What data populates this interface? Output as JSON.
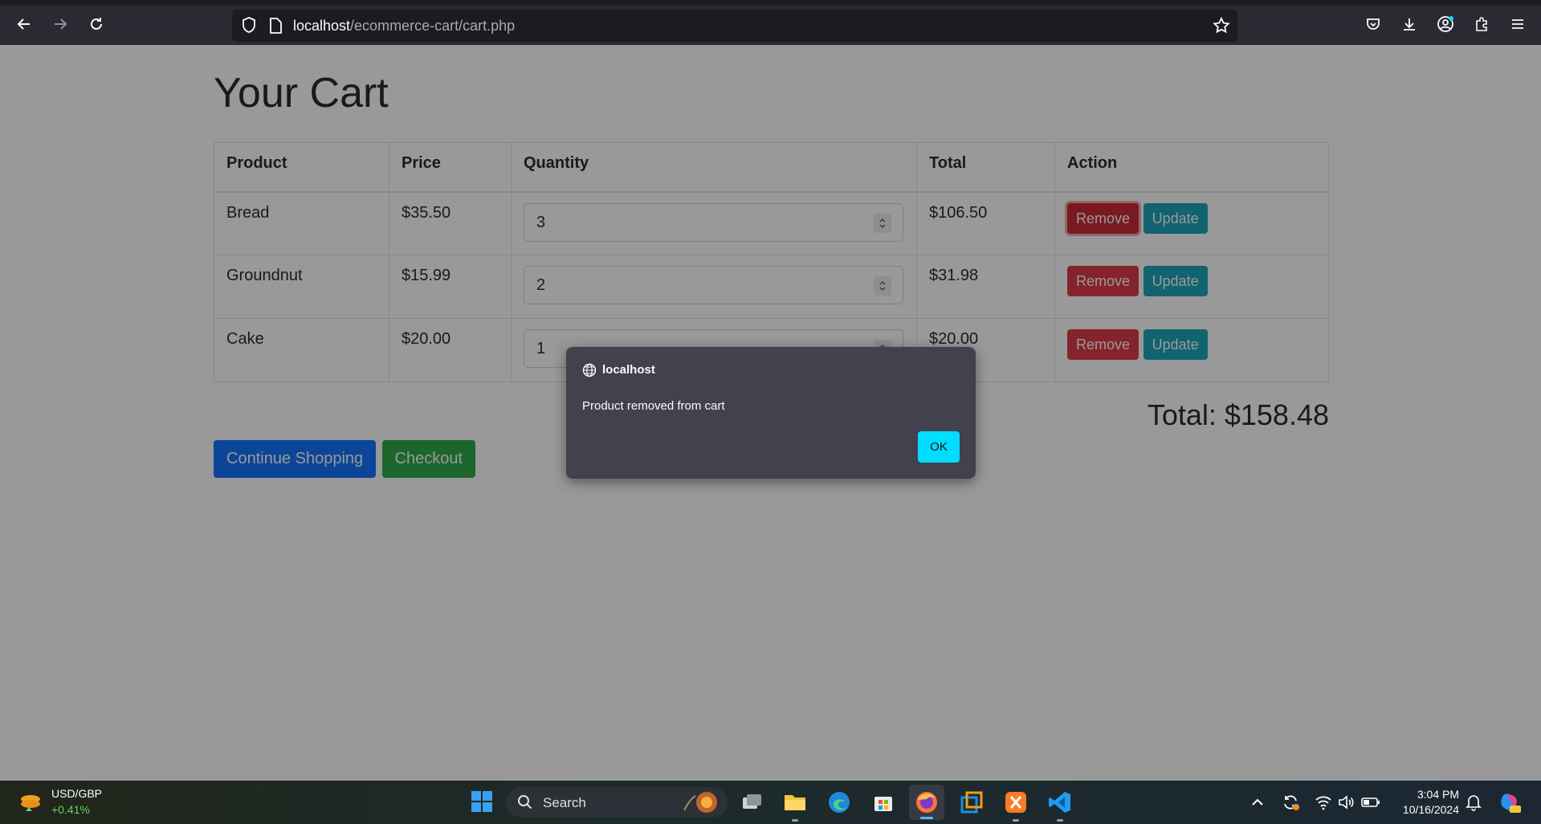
{
  "browser": {
    "url_host": "localhost",
    "url_path": "/ecommerce-cart/cart.php"
  },
  "page": {
    "title": "Your Cart",
    "table": {
      "headers": [
        "Product",
        "Price",
        "Quantity",
        "Total",
        "Action"
      ],
      "rows": [
        {
          "product": "Bread",
          "price": "$35.50",
          "quantity": "3",
          "total": "$106.50",
          "remove_label": "Remove",
          "update_label": "Update"
        },
        {
          "product": "Groundnut",
          "price": "$15.99",
          "quantity": "2",
          "total": "$31.98",
          "remove_label": "Remove",
          "update_label": "Update"
        },
        {
          "product": "Cake",
          "price": "$20.00",
          "quantity": "1",
          "total": "$20.00",
          "remove_label": "Remove",
          "update_label": "Update"
        }
      ]
    },
    "grand_total": "Total: $158.48",
    "continue_label": "Continue Shopping",
    "checkout_label": "Checkout"
  },
  "dialog": {
    "origin": "localhost",
    "message": "Product removed from cart",
    "ok_label": "OK"
  },
  "taskbar": {
    "widget_label": "USD/GBP",
    "widget_value": "+0.41%",
    "search_label": "Search",
    "time": "3:04 PM",
    "date": "10/16/2024"
  },
  "colors": {
    "danger": "#dc3545",
    "info": "#17a2b8",
    "primary": "#0d6efd",
    "success": "#28a745",
    "dialog_ok": "#00ddff"
  }
}
